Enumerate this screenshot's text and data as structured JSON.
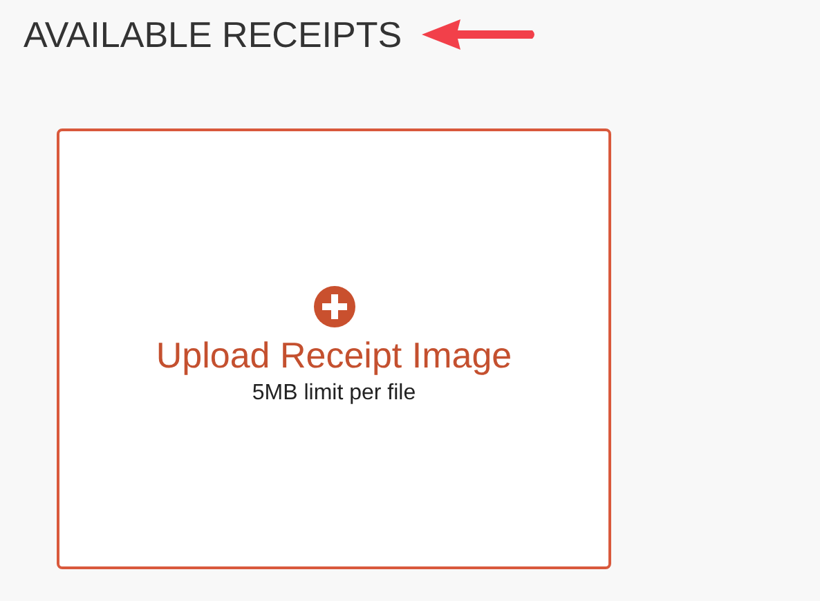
{
  "heading": "AVAILABLE RECEIPTS",
  "upload_card": {
    "title": "Upload Receipt Image",
    "note": "5MB limit per file"
  }
}
